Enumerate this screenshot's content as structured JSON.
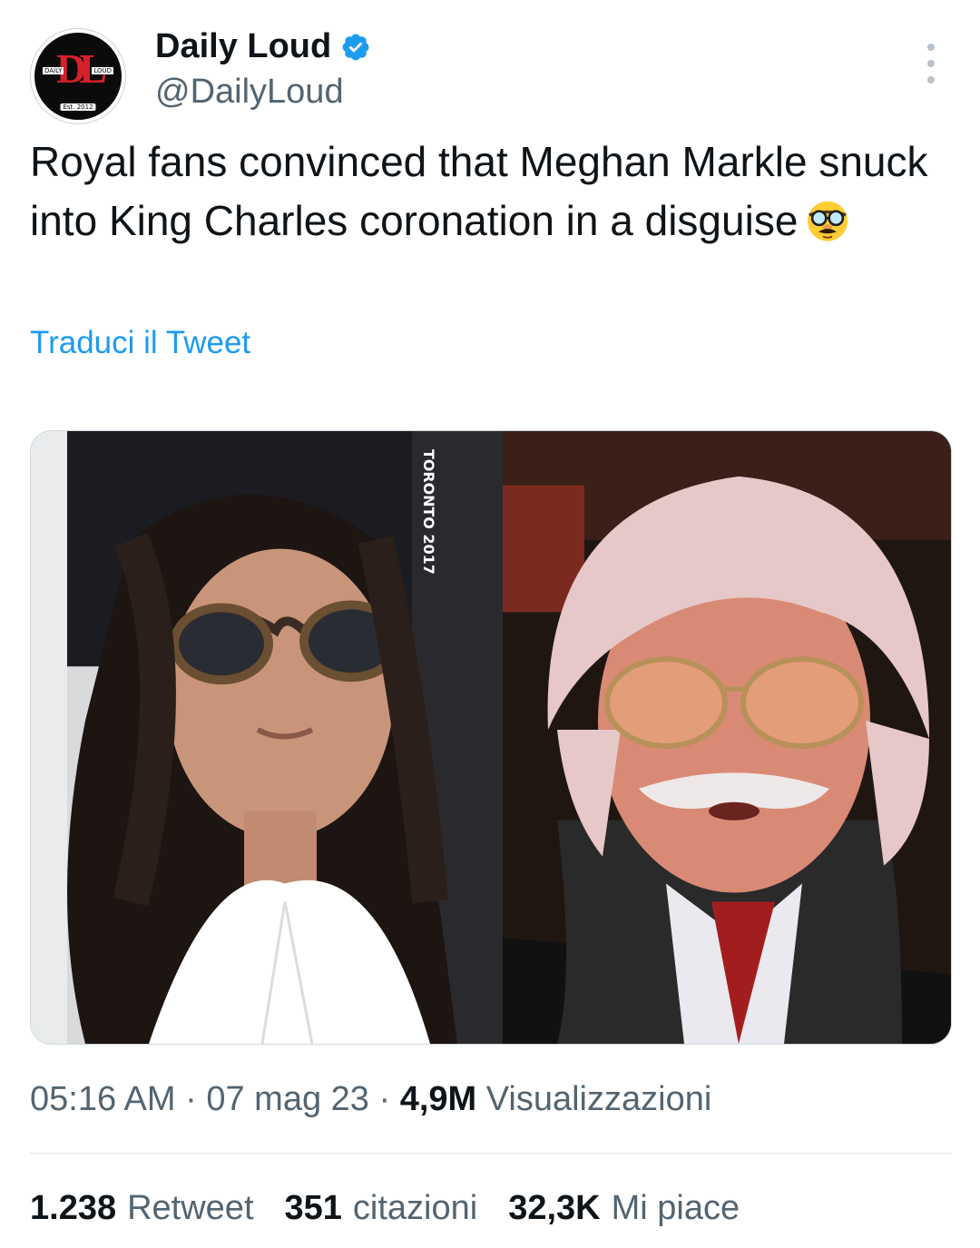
{
  "author": {
    "display_name": "Daily Loud",
    "handle": "@DailyLoud",
    "verified_icon": "verified-badge-icon",
    "avatar_logo": "DL",
    "avatar_left": "DAILY",
    "avatar_right": "LOUD",
    "avatar_bottom": "Est. 2012"
  },
  "tweet": {
    "text": "Royal fans convinced that Meghan Markle snuck into King Charles coronation in a disguise",
    "emoji": "disguised-face-emoji",
    "translate_label": "Traduci il Tweet"
  },
  "media": {
    "photo_left_text": "TORONTO 2017"
  },
  "meta": {
    "time": "05:16 AM",
    "separator": " · ",
    "date": "07 mag 23",
    "views_count": "4,9M",
    "views_label": "Visualizzazioni"
  },
  "stats": {
    "retweets_count": "1.238",
    "retweets_label": "Retweet",
    "quotes_count": "351",
    "quotes_label": "citazioni",
    "likes_count": "32,3K",
    "likes_label": "Mi piace"
  },
  "colors": {
    "accent": "#1d9bf0",
    "secondary_text": "#536471",
    "primary_text": "#0f1419"
  }
}
